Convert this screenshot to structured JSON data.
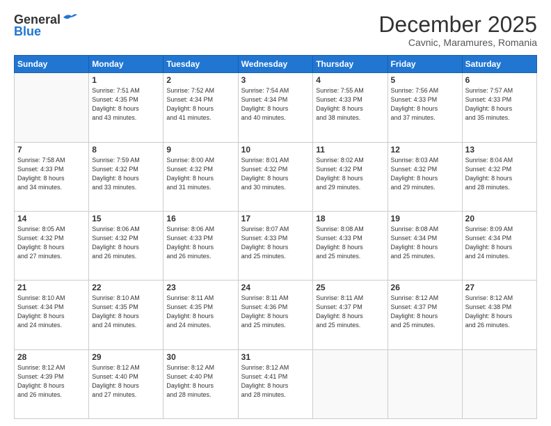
{
  "header": {
    "logo_general": "General",
    "logo_blue": "Blue",
    "month_title": "December 2025",
    "subtitle": "Cavnic, Maramures, Romania"
  },
  "days_of_week": [
    "Sunday",
    "Monday",
    "Tuesday",
    "Wednesday",
    "Thursday",
    "Friday",
    "Saturday"
  ],
  "weeks": [
    [
      {
        "day": "",
        "info": ""
      },
      {
        "day": "1",
        "info": "Sunrise: 7:51 AM\nSunset: 4:35 PM\nDaylight: 8 hours\nand 43 minutes."
      },
      {
        "day": "2",
        "info": "Sunrise: 7:52 AM\nSunset: 4:34 PM\nDaylight: 8 hours\nand 41 minutes."
      },
      {
        "day": "3",
        "info": "Sunrise: 7:54 AM\nSunset: 4:34 PM\nDaylight: 8 hours\nand 40 minutes."
      },
      {
        "day": "4",
        "info": "Sunrise: 7:55 AM\nSunset: 4:33 PM\nDaylight: 8 hours\nand 38 minutes."
      },
      {
        "day": "5",
        "info": "Sunrise: 7:56 AM\nSunset: 4:33 PM\nDaylight: 8 hours\nand 37 minutes."
      },
      {
        "day": "6",
        "info": "Sunrise: 7:57 AM\nSunset: 4:33 PM\nDaylight: 8 hours\nand 35 minutes."
      }
    ],
    [
      {
        "day": "7",
        "info": "Sunrise: 7:58 AM\nSunset: 4:33 PM\nDaylight: 8 hours\nand 34 minutes."
      },
      {
        "day": "8",
        "info": "Sunrise: 7:59 AM\nSunset: 4:32 PM\nDaylight: 8 hours\nand 33 minutes."
      },
      {
        "day": "9",
        "info": "Sunrise: 8:00 AM\nSunset: 4:32 PM\nDaylight: 8 hours\nand 31 minutes."
      },
      {
        "day": "10",
        "info": "Sunrise: 8:01 AM\nSunset: 4:32 PM\nDaylight: 8 hours\nand 30 minutes."
      },
      {
        "day": "11",
        "info": "Sunrise: 8:02 AM\nSunset: 4:32 PM\nDaylight: 8 hours\nand 29 minutes."
      },
      {
        "day": "12",
        "info": "Sunrise: 8:03 AM\nSunset: 4:32 PM\nDaylight: 8 hours\nand 29 minutes."
      },
      {
        "day": "13",
        "info": "Sunrise: 8:04 AM\nSunset: 4:32 PM\nDaylight: 8 hours\nand 28 minutes."
      }
    ],
    [
      {
        "day": "14",
        "info": "Sunrise: 8:05 AM\nSunset: 4:32 PM\nDaylight: 8 hours\nand 27 minutes."
      },
      {
        "day": "15",
        "info": "Sunrise: 8:06 AM\nSunset: 4:32 PM\nDaylight: 8 hours\nand 26 minutes."
      },
      {
        "day": "16",
        "info": "Sunrise: 8:06 AM\nSunset: 4:33 PM\nDaylight: 8 hours\nand 26 minutes."
      },
      {
        "day": "17",
        "info": "Sunrise: 8:07 AM\nSunset: 4:33 PM\nDaylight: 8 hours\nand 25 minutes."
      },
      {
        "day": "18",
        "info": "Sunrise: 8:08 AM\nSunset: 4:33 PM\nDaylight: 8 hours\nand 25 minutes."
      },
      {
        "day": "19",
        "info": "Sunrise: 8:08 AM\nSunset: 4:34 PM\nDaylight: 8 hours\nand 25 minutes."
      },
      {
        "day": "20",
        "info": "Sunrise: 8:09 AM\nSunset: 4:34 PM\nDaylight: 8 hours\nand 24 minutes."
      }
    ],
    [
      {
        "day": "21",
        "info": "Sunrise: 8:10 AM\nSunset: 4:34 PM\nDaylight: 8 hours\nand 24 minutes."
      },
      {
        "day": "22",
        "info": "Sunrise: 8:10 AM\nSunset: 4:35 PM\nDaylight: 8 hours\nand 24 minutes."
      },
      {
        "day": "23",
        "info": "Sunrise: 8:11 AM\nSunset: 4:35 PM\nDaylight: 8 hours\nand 24 minutes."
      },
      {
        "day": "24",
        "info": "Sunrise: 8:11 AM\nSunset: 4:36 PM\nDaylight: 8 hours\nand 25 minutes."
      },
      {
        "day": "25",
        "info": "Sunrise: 8:11 AM\nSunset: 4:37 PM\nDaylight: 8 hours\nand 25 minutes."
      },
      {
        "day": "26",
        "info": "Sunrise: 8:12 AM\nSunset: 4:37 PM\nDaylight: 8 hours\nand 25 minutes."
      },
      {
        "day": "27",
        "info": "Sunrise: 8:12 AM\nSunset: 4:38 PM\nDaylight: 8 hours\nand 26 minutes."
      }
    ],
    [
      {
        "day": "28",
        "info": "Sunrise: 8:12 AM\nSunset: 4:39 PM\nDaylight: 8 hours\nand 26 minutes."
      },
      {
        "day": "29",
        "info": "Sunrise: 8:12 AM\nSunset: 4:40 PM\nDaylight: 8 hours\nand 27 minutes."
      },
      {
        "day": "30",
        "info": "Sunrise: 8:12 AM\nSunset: 4:40 PM\nDaylight: 8 hours\nand 28 minutes."
      },
      {
        "day": "31",
        "info": "Sunrise: 8:12 AM\nSunset: 4:41 PM\nDaylight: 8 hours\nand 28 minutes."
      },
      {
        "day": "",
        "info": ""
      },
      {
        "day": "",
        "info": ""
      },
      {
        "day": "",
        "info": ""
      }
    ]
  ]
}
